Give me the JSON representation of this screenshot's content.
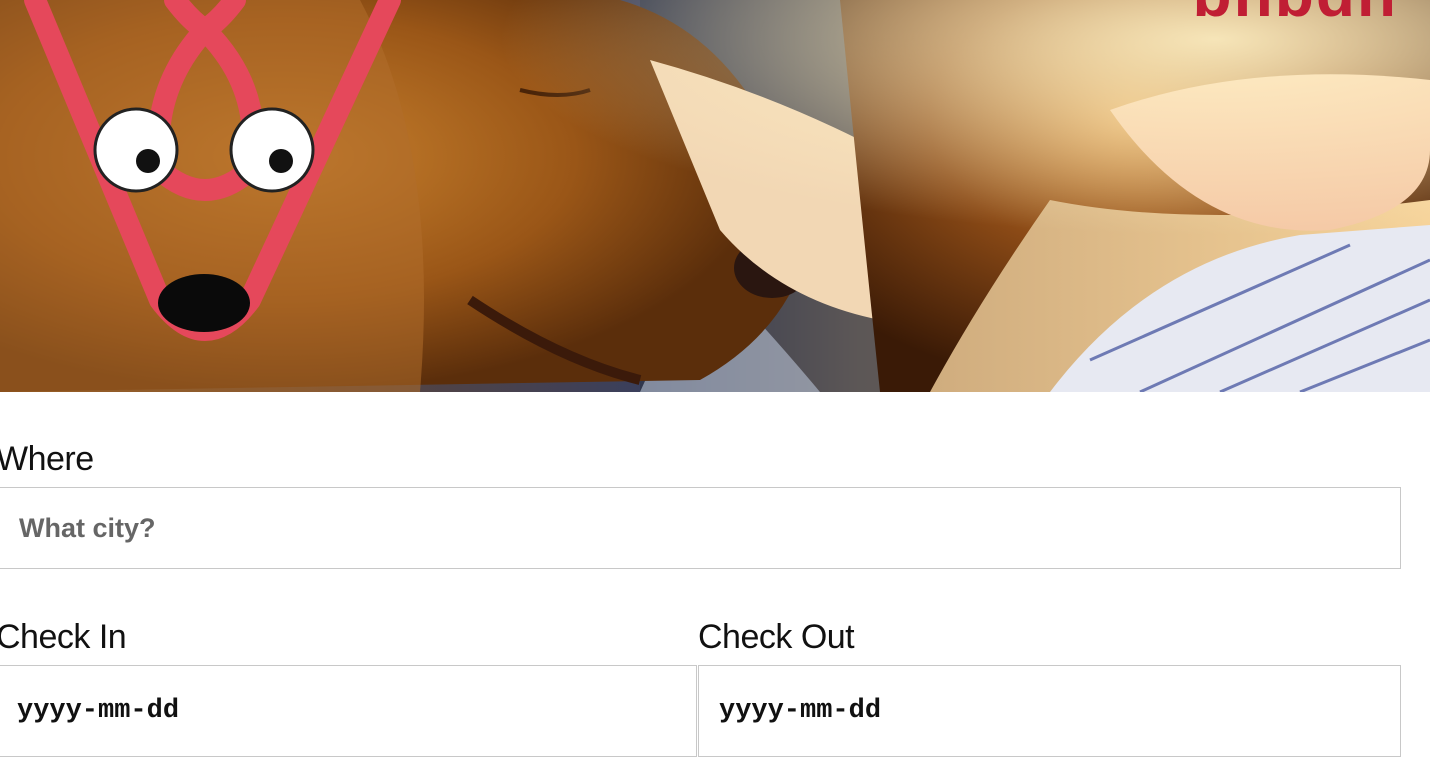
{
  "brand": {
    "name": "bnbdn",
    "accent": "#e5485b"
  },
  "hero": {
    "image": "photo of a golden retriever with a woman, logo mascot overlay"
  },
  "form": {
    "where": {
      "label": "Where",
      "placeholder": "What city?"
    },
    "check_in": {
      "label": "Check In",
      "placeholder": "yyyy-mm-dd"
    },
    "check_out": {
      "label": "Check Out",
      "placeholder": "yyyy-mm-dd"
    }
  },
  "icons": {
    "logo": "airbnb-mascot-logo-icon"
  }
}
